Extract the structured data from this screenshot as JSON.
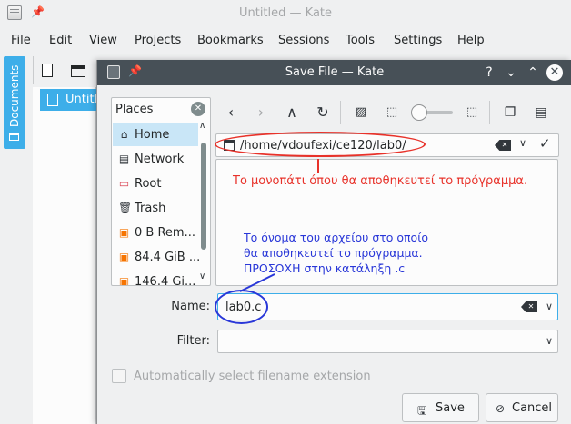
{
  "window": {
    "title": "Untitled — Kate"
  },
  "menubar": {
    "items": [
      "File",
      "Edit",
      "View",
      "Projects",
      "Bookmarks",
      "Sessions",
      "Tools",
      "Settings",
      "Help"
    ]
  },
  "sidebar": {
    "tab_label": "Documents",
    "document_label": "Untitled"
  },
  "dialog": {
    "title": "Save File — Kate",
    "title_buttons": [
      "?",
      "v",
      "^",
      "x"
    ],
    "places": {
      "title": "Places",
      "items": [
        {
          "label": "Home",
          "icon": "home-icon",
          "selected": true
        },
        {
          "label": "Network",
          "icon": "network-icon"
        },
        {
          "label": "Root",
          "icon": "root-folder-icon"
        },
        {
          "label": "Trash",
          "icon": "trash-icon"
        },
        {
          "label": "0 B Rem...",
          "icon": "drive-icon"
        },
        {
          "label": "84.4 GiB ...",
          "icon": "drive-icon"
        },
        {
          "label": "146.4 Gi...",
          "icon": "drive-icon"
        }
      ]
    },
    "path": "/home/vdoufexi/ce120/lab0/",
    "name_label": "Name:",
    "name_value": "lab0.c",
    "filter_label": "Filter:",
    "filter_value": "",
    "auto_extension_label": "Automatically select filename extension",
    "auto_extension_checked": false,
    "save_label": "Save",
    "cancel_label": "Cancel"
  },
  "annotations": {
    "path_note": "Το μονοπάτι όπου θα αποθηκευτεί το πρόγραμμα.",
    "name_note": [
      "Το όνομα του αρχείου στο οποίο",
      "θα αποθηκευτεί το πρόγραμμα.",
      "ΠΡΟΣΟΧΗ στην κατάληξη .c"
    ],
    "path_note_color": "#e8322a",
    "name_note_color": "#2937d8"
  },
  "colors": {
    "accent": "#3daee9",
    "dialog_titlebar": "#475057"
  }
}
